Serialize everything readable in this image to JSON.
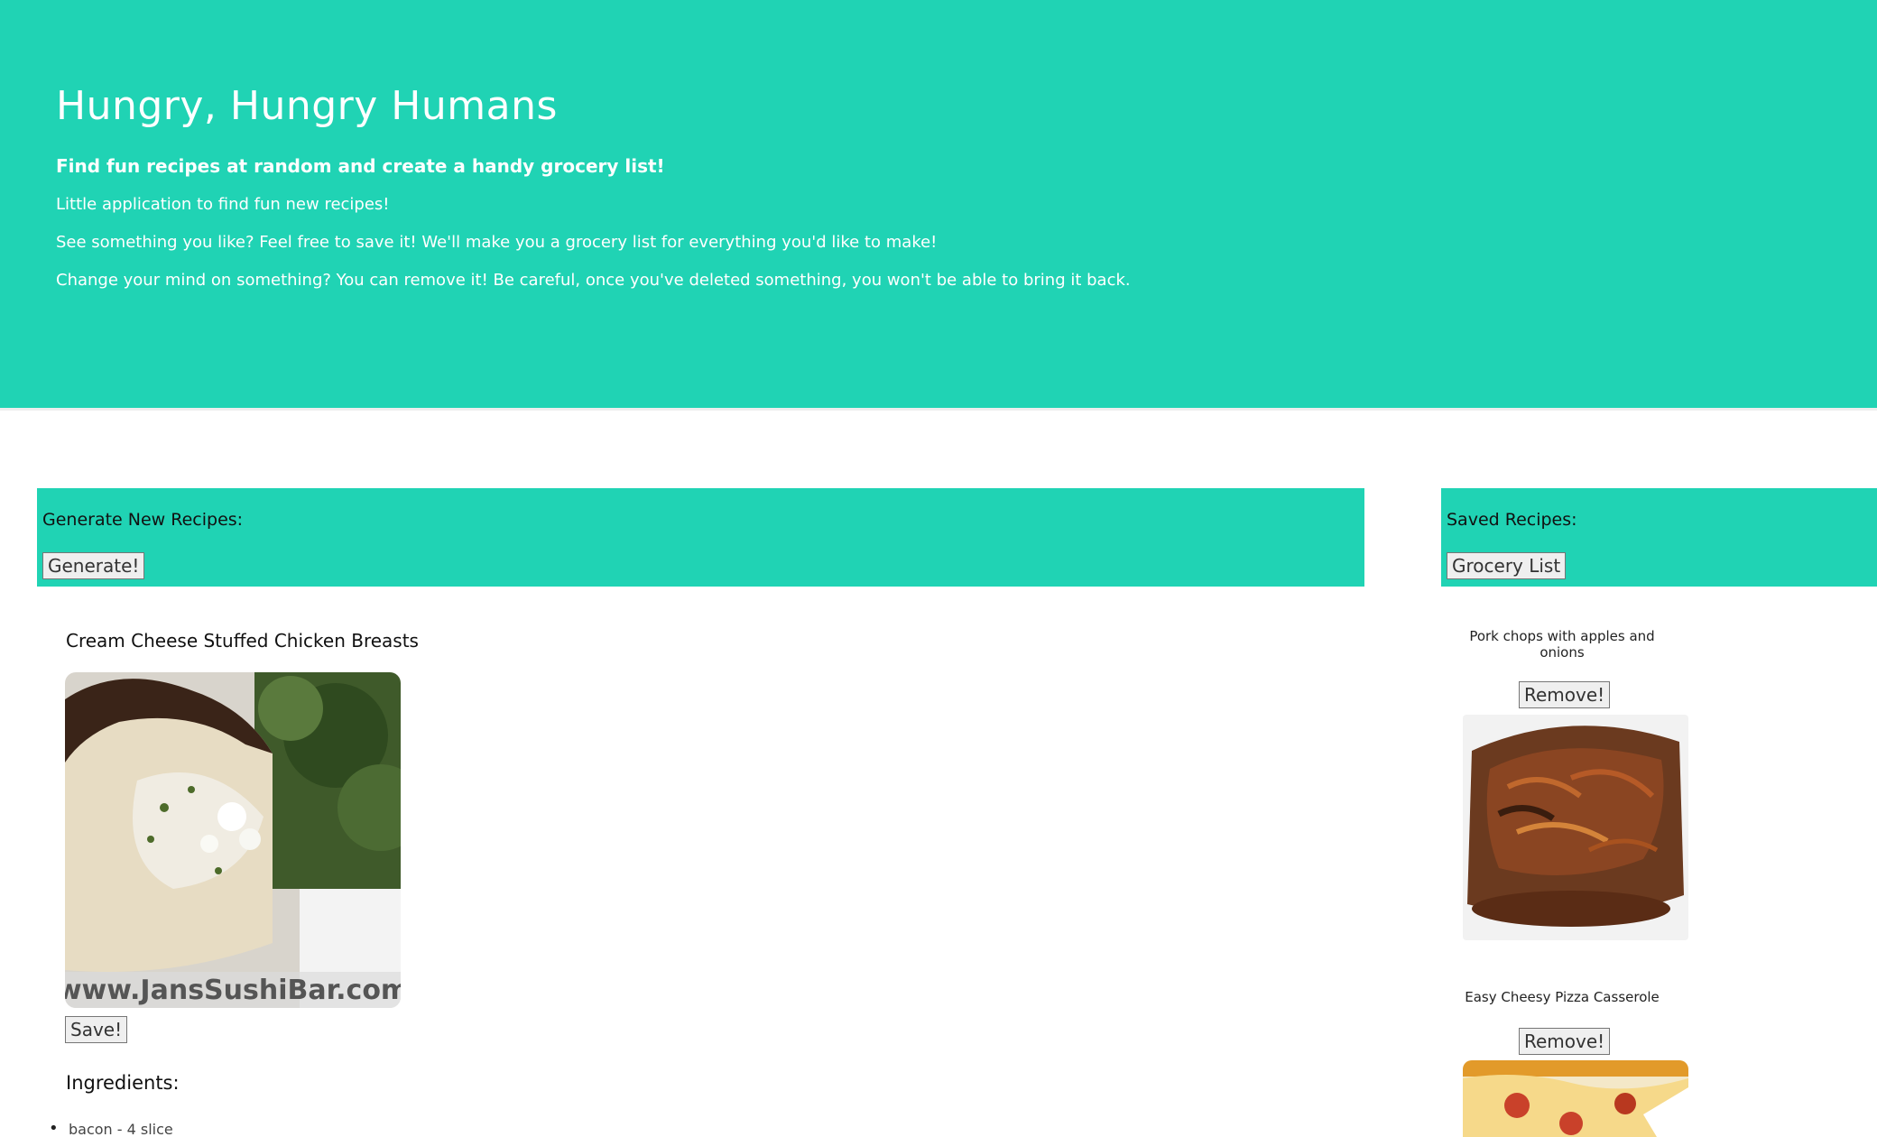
{
  "header": {
    "title": "Hungry, Hungry Humans",
    "tagline": "Find fun recipes at random and create a handy grocery list!",
    "lines": [
      "Little application to find fun new recipes!",
      "See something you like? Feel free to save it! We'll make you a grocery list for everything you'd like to make!",
      "Change your mind on something? You can remove it! Be careful, once you've deleted something, you won't be able to bring it back."
    ]
  },
  "generate_panel": {
    "title": "Generate New Recipes:",
    "button_label": "Generate!"
  },
  "saved_panel": {
    "title": "Saved Recipes:",
    "button_label": "Grocery List"
  },
  "current_recipe": {
    "title": "Cream Cheese Stuffed Chicken Breasts",
    "image_watermark": "www.JansSushiBar.com",
    "save_label": "Save!",
    "ingredients_title": "Ingredients:",
    "ingredients": [
      "bacon - 4 slice"
    ]
  },
  "saved_recipes": [
    {
      "title": "Pork chops with apples and onions",
      "remove_label": "Remove!"
    },
    {
      "title": "Easy Cheesy Pizza Casserole",
      "remove_label": "Remove!"
    }
  ],
  "colors": {
    "accent": "#20d3b4",
    "button_bg": "#efefef",
    "button_border": "#767676"
  }
}
